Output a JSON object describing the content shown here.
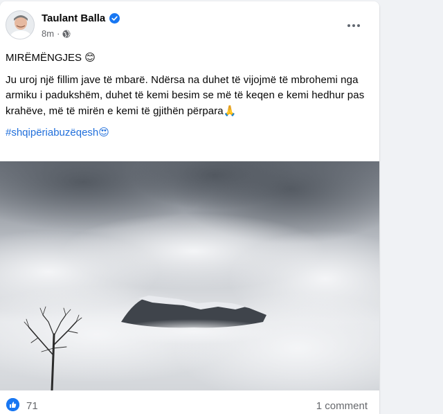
{
  "post": {
    "author": "Taulant Balla",
    "time": "8m",
    "separator": "·",
    "greeting": "MIRËMËNGJES",
    "greeting_emoji": "😊",
    "body": "Ju uroj një fillim jave të mbarë. Ndërsa na duhet të vijojmë të mbrohemi nga armiku i padukshëm, duhet të kemi besim se më të keqen e kemi hedhur pas krahëve, më të mirën e kemi të gjithën përpara",
    "body_emoji": "🙏",
    "hashtag": "#shqipëriabuzëqesh",
    "hashtag_emoji": "😍"
  },
  "reactions": {
    "like_count": "71",
    "comments": "1 comment"
  },
  "colors": {
    "link": "#216fdb",
    "like": "#1877f2",
    "verified": "#1877f2"
  },
  "icons": [
    "verified-badge-icon",
    "globe-icon",
    "more-options-icon",
    "like-reaction-icon"
  ]
}
